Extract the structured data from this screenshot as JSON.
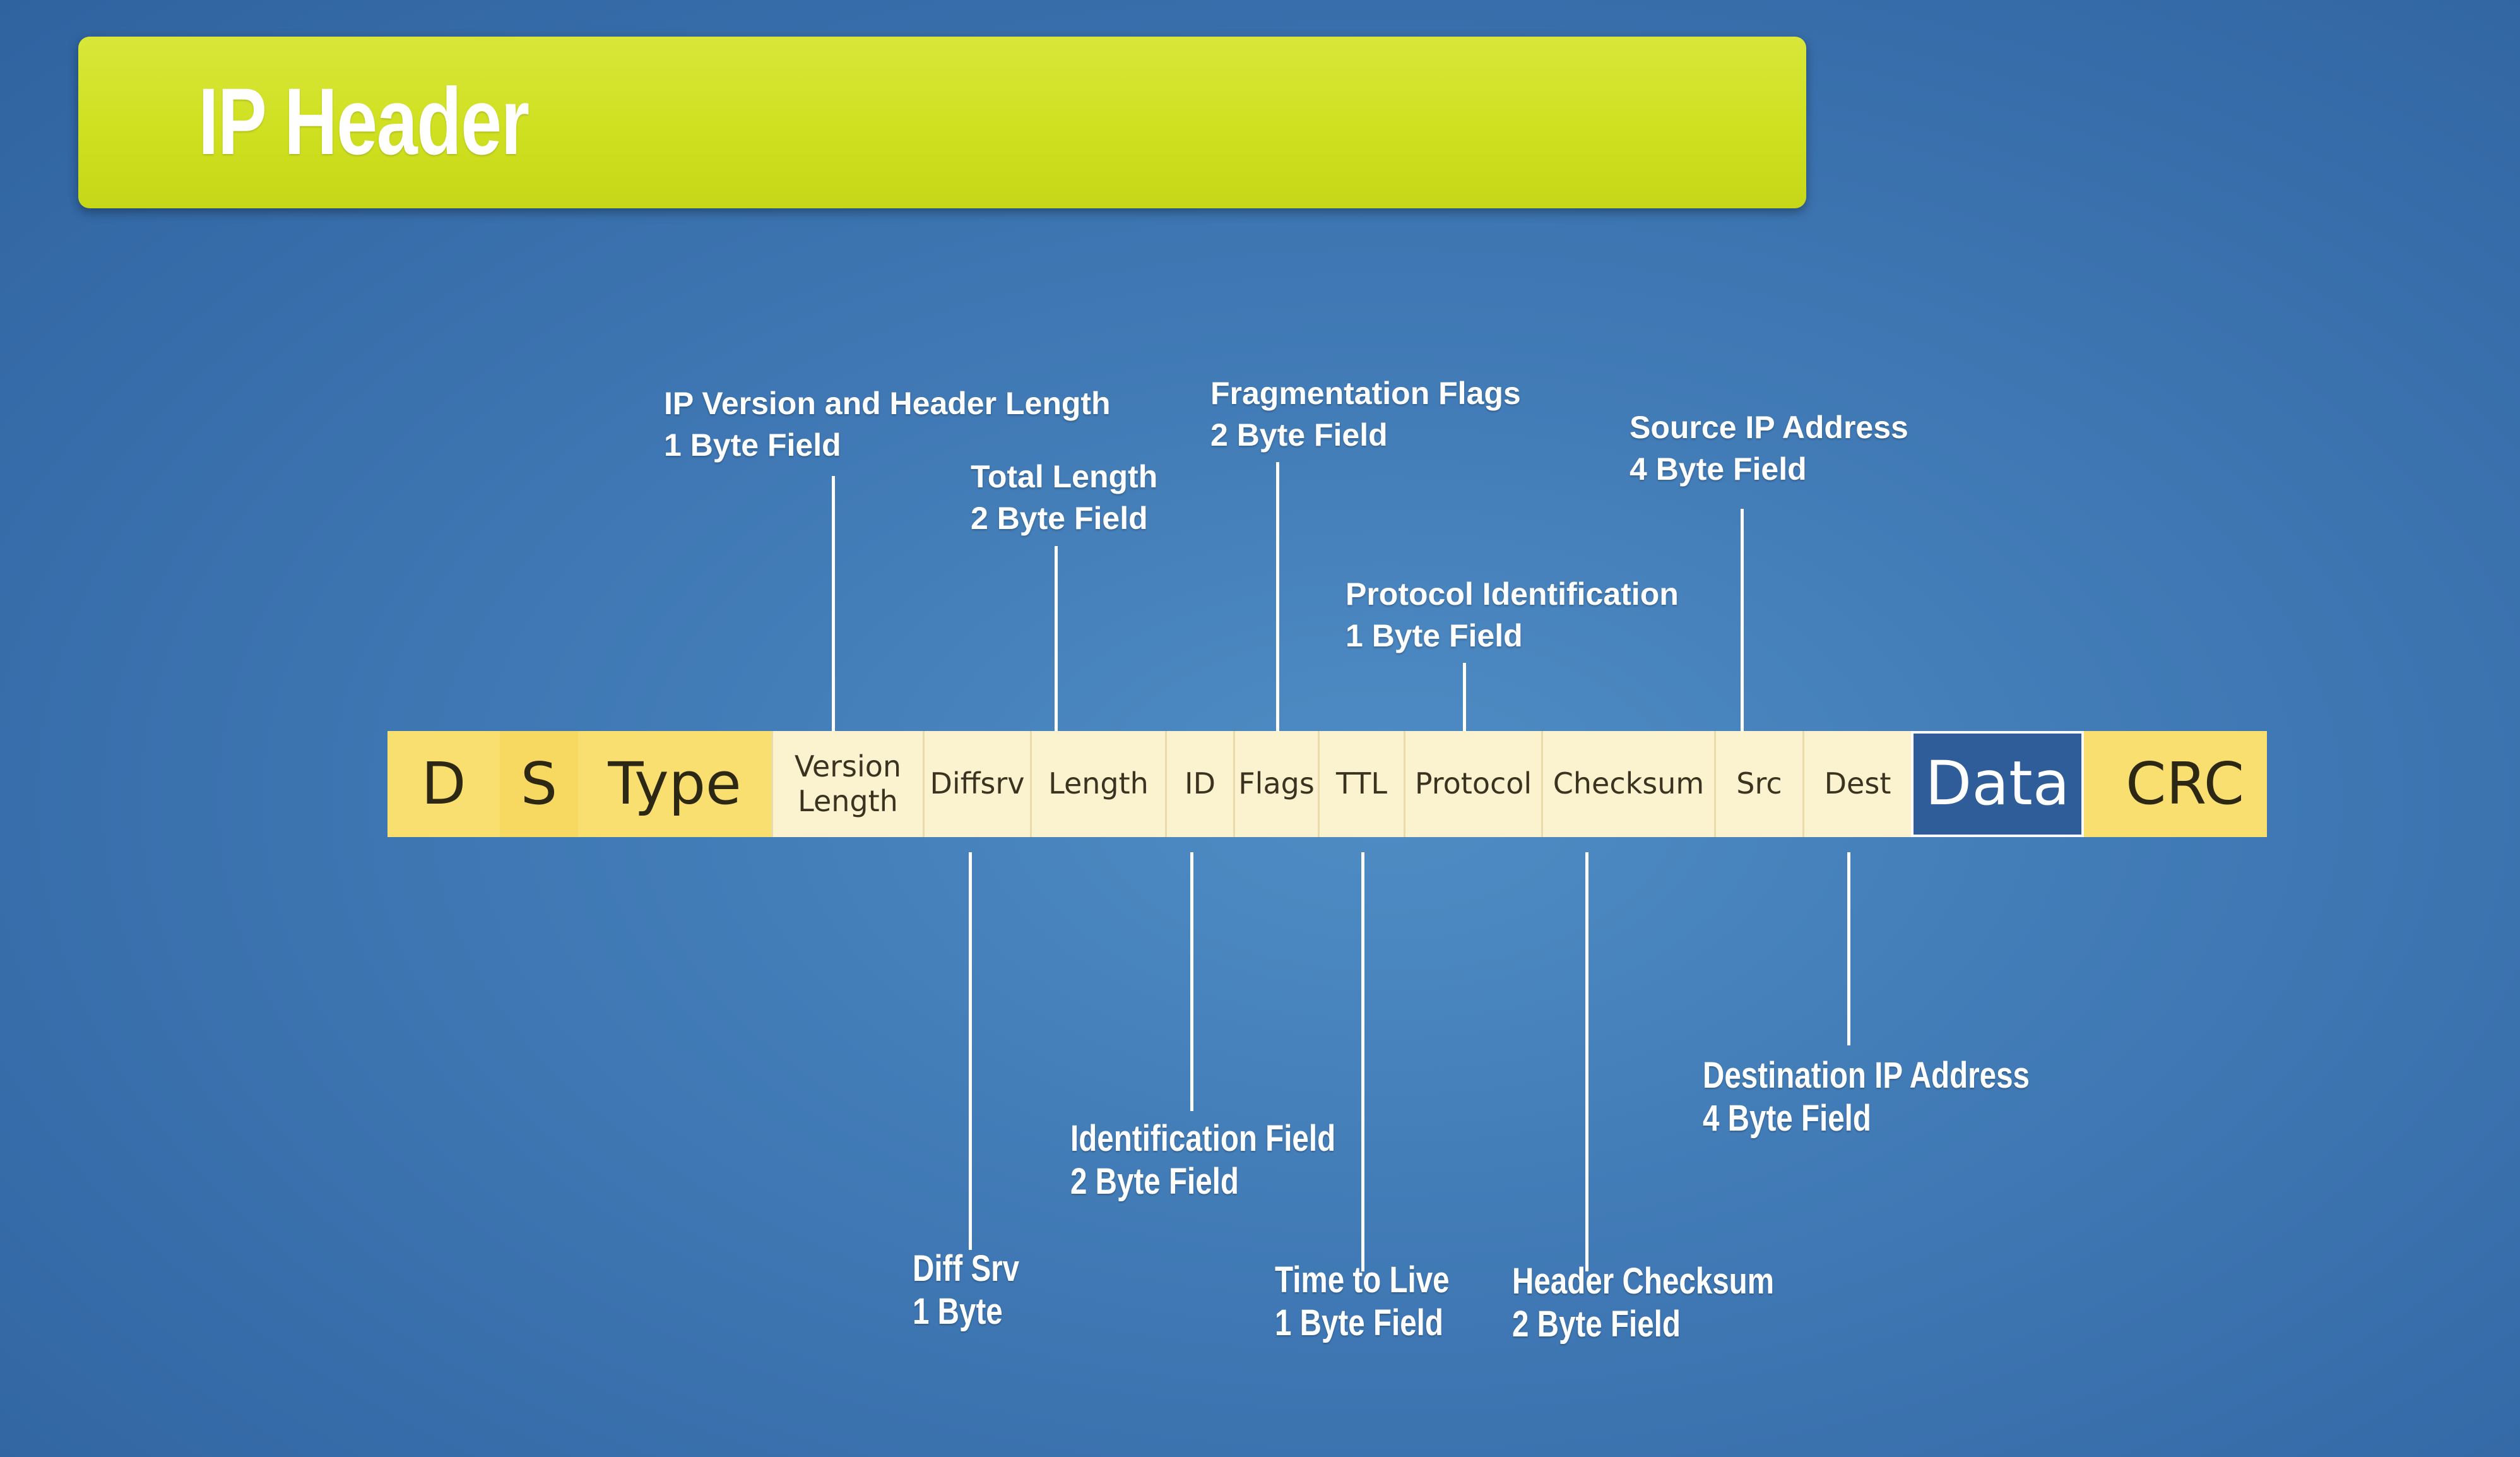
{
  "title": "IP Header",
  "bar": {
    "d": "D",
    "s": "S",
    "type": "Type",
    "version_length_line1": "Version",
    "version_length_line2": "Length",
    "diffsrv": "Diffsrv",
    "length": "Length",
    "id": "ID",
    "flags": "Flags",
    "ttl": "TTL",
    "protocol": "Protocol",
    "checksum": "Checksum",
    "src": "Src",
    "dest": "Dest",
    "data": "Data",
    "crc": "CRC"
  },
  "callouts_top": {
    "version": {
      "line1": "IP Version and Header Length",
      "line2": "1 Byte Field"
    },
    "total_length": {
      "line1": "Total Length",
      "line2": "2 Byte Field"
    },
    "frag_flags": {
      "line1": "Fragmentation Flags",
      "line2": "2 Byte Field"
    },
    "protocol": {
      "line1": "Protocol Identification",
      "line2": "1 Byte Field"
    },
    "source_ip": {
      "line1": "Source IP Address",
      "line2": "4 Byte Field"
    }
  },
  "callouts_bottom": {
    "diff_srv": {
      "line1": "Diff Srv",
      "line2": "1 Byte"
    },
    "identification": {
      "line1": "Identification Field",
      "line2": "2 Byte Field"
    },
    "ttl": {
      "line1": "Time to Live",
      "line2": "1 Byte Field"
    },
    "checksum": {
      "line1": "Header Checksum",
      "line2": "2 Byte Field"
    },
    "dest_ip": {
      "line1": "Destination IP Address",
      "line2": "4 Byte Field"
    }
  },
  "colors": {
    "background": "#3f78b4",
    "title_bar": "#cfe020",
    "bar_yellow": "#f9de70",
    "bar_cream": "#fbf2cf",
    "data_cell": "#2e5d99"
  }
}
